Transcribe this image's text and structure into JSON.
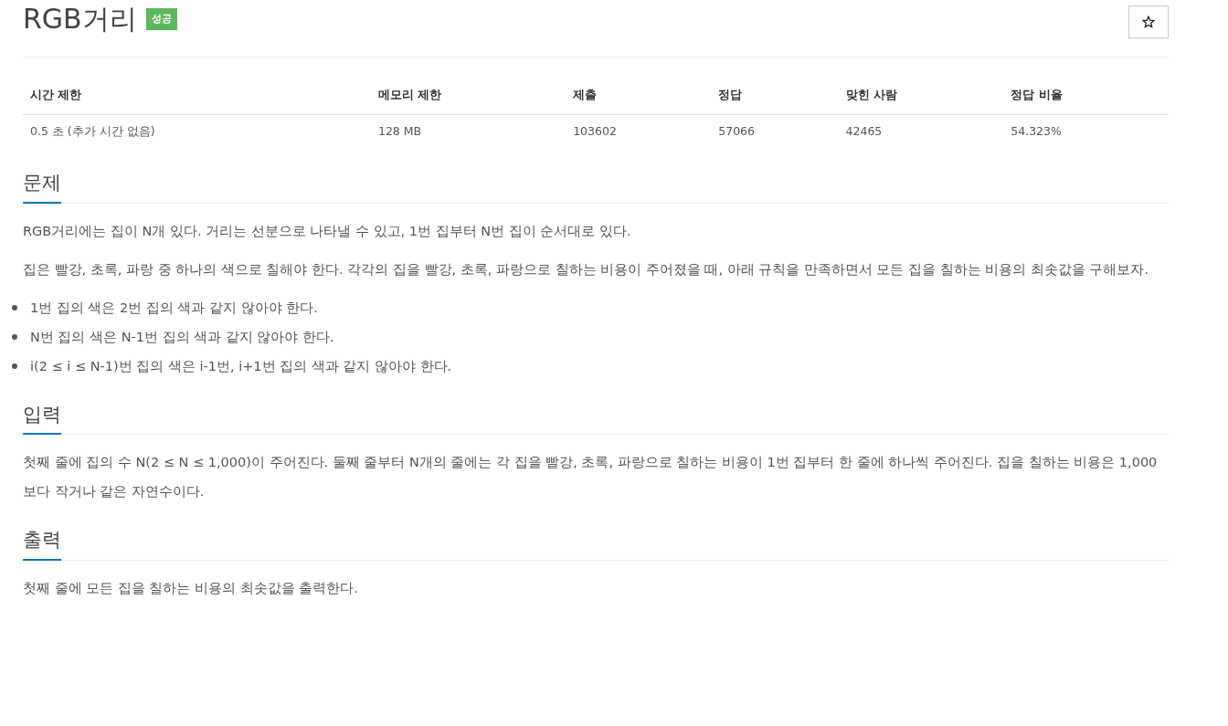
{
  "problem": {
    "title": "RGB거리",
    "badge": "성공",
    "starred": false
  },
  "limits": {
    "columns": [
      "시간 제한",
      "메모리 제한",
      "제출",
      "정답",
      "맞힌 사람",
      "정답 비율"
    ],
    "row": [
      "0.5 초 (추가 시간 없음)",
      "128 MB",
      "103602",
      "57066",
      "42465",
      "54.323%"
    ]
  },
  "sections": [
    {
      "heading": "문제",
      "blocks": [
        {
          "kind": "paragraph",
          "text": "RGB거리에는 집이 N개 있다. 거리는 선분으로 나타낼 수 있고, 1번 집부터 N번 집이 순서대로 있다."
        },
        {
          "kind": "paragraph",
          "text": "집은 빨강, 초록, 파랑 중 하나의 색으로 칠해야 한다. 각각의 집을 빨강, 초록, 파랑으로 칠하는 비용이 주어졌을 때, 아래 규칙을 만족하면서 모든 집을 칠하는 비용의 최솟값을 구해보자."
        },
        {
          "kind": "list",
          "items": [
            "1번 집의 색은 2번 집의 색과 같지 않아야 한다.",
            "N번 집의 색은 N-1번 집의 색과 같지 않아야 한다.",
            "i(2 ≤ i ≤ N-1)번 집의 색은 i-1번, i+1번 집의 색과 같지 않아야 한다."
          ]
        }
      ]
    },
    {
      "heading": "입력",
      "blocks": [
        {
          "kind": "paragraph",
          "text": "첫째 줄에 집의 수 N(2 ≤ N ≤ 1,000)이 주어진다. 둘째 줄부터 N개의 줄에는 각 집을 빨강, 초록, 파랑으로 칠하는 비용이 1번 집부터 한 줄에 하나씩 주어진다. 집을 칠하는 비용은 1,000보다 작거나 같은 자연수이다."
        }
      ]
    },
    {
      "heading": "출력",
      "blocks": [
        {
          "kind": "paragraph",
          "text": "첫째 줄에 모든 집을 칠하는 비용의 최솟값을 출력한다."
        }
      ]
    }
  ]
}
